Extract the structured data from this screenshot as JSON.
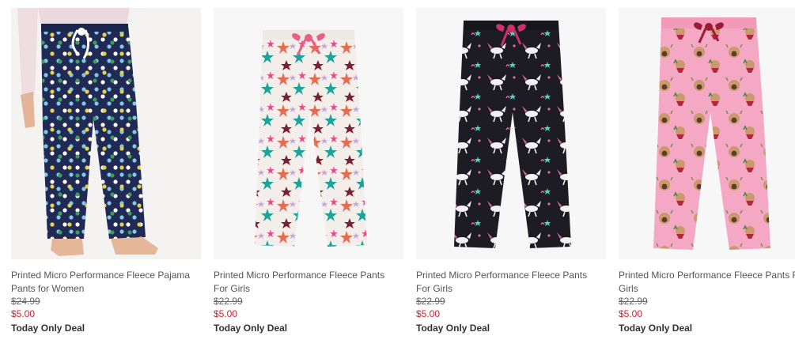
{
  "products": [
    {
      "title": "Printed Micro Performance Fleece Pajama Pants for Women",
      "original_price": "$24.99",
      "sale_price": "$5.00",
      "deal_label": "Today Only Deal",
      "pattern": "polka-dots",
      "colors": {
        "base": "#202a55",
        "accent": "#7fc8e8"
      }
    },
    {
      "title": "Printed Micro Performance Fleece Pants For Girls",
      "original_price": "$22.99",
      "sale_price": "$5.00",
      "deal_label": "Today Only Deal",
      "pattern": "stars",
      "colors": {
        "base": "#f3eee9",
        "accent": "#e66b4f"
      }
    },
    {
      "title": "Printed Micro Performance Fleece Pants For Girls",
      "original_price": "$22.99",
      "sale_price": "$5.00",
      "deal_label": "Today Only Deal",
      "pattern": "unicorns",
      "colors": {
        "base": "#1c1c22",
        "accent": "#e36aa8"
      }
    },
    {
      "title": "Printed Micro Performance Fleece Pants For Girls",
      "original_price": "$22.99",
      "sale_price": "$5.00",
      "deal_label": "Today Only Deal",
      "pattern": "pugs",
      "colors": {
        "base": "#f5a8c4",
        "accent": "#b3273b"
      }
    }
  ]
}
